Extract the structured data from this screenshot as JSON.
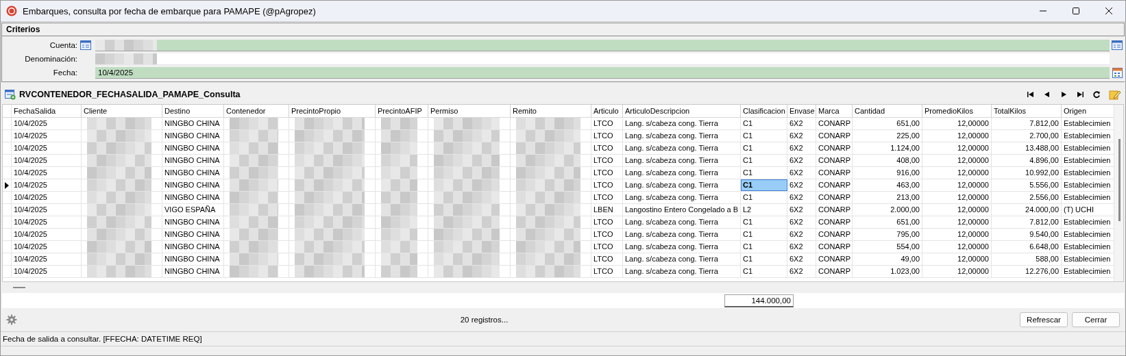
{
  "window": {
    "title": "Embarques, consulta por fecha de embarque para PAMAPE (@pAgropez)"
  },
  "criteria": {
    "title": "Criterios",
    "fields": [
      {
        "kind": "lookup",
        "label": "Cuenta:",
        "required": true
      },
      {
        "kind": "text",
        "label": "Denominación:",
        "required": false
      },
      {
        "kind": "date",
        "label": "Fecha:",
        "required": true,
        "value": "10/4/2025"
      }
    ]
  },
  "grid": {
    "title": "RVCONTENEDOR_FECHASALIDA_PAMAPE_Consulta",
    "columns": [
      "FechaSalida",
      "Cliente",
      "Destino",
      "Contenedor",
      "PrecintoPropio",
      "PrecintoAFIP",
      "Permiso",
      "Remito",
      "Articulo",
      "ArticuloDescripcion",
      "Clasificacion",
      "Envase",
      "Marca",
      "Cantidad",
      "PromedioKilos",
      "TotalKilos",
      "Origen"
    ],
    "rows": [
      {
        "current": false,
        "cells": [
          "10/4/2025",
          null,
          "NINGBO CHINA",
          null,
          null,
          null,
          null,
          null,
          "LTCO",
          "Lang. s/cabeza cong. Tierra",
          "C1",
          "6X2",
          "CONARP",
          "651,00",
          "12,00000",
          "7.812,00",
          "Establecimien"
        ]
      },
      {
        "current": false,
        "cells": [
          "10/4/2025",
          null,
          "NINGBO CHINA",
          null,
          null,
          null,
          null,
          null,
          "LTCO",
          "Lang. s/cabeza cong. Tierra",
          "C1",
          "6X2",
          "CONARP",
          "225,00",
          "12,00000",
          "2.700,00",
          "Establecimien"
        ]
      },
      {
        "current": false,
        "cells": [
          "10/4/2025",
          null,
          "NINGBO CHINA",
          null,
          null,
          null,
          null,
          null,
          "LTCO",
          "Lang. s/cabeza cong. Tierra",
          "C1",
          "6X2",
          "CONARP",
          "1.124,00",
          "12,00000",
          "13.488,00",
          "Establecimien"
        ]
      },
      {
        "current": false,
        "cells": [
          "10/4/2025",
          null,
          "NINGBO CHINA",
          null,
          null,
          null,
          null,
          null,
          "LTCO",
          "Lang. s/cabeza cong. Tierra",
          "C1",
          "6X2",
          "CONARP",
          "408,00",
          "12,00000",
          "4.896,00",
          "Establecimien"
        ]
      },
      {
        "current": false,
        "cells": [
          "10/4/2025",
          null,
          "NINGBO CHINA",
          null,
          null,
          null,
          null,
          null,
          "LTCO",
          "Lang. s/cabeza cong. Tierra",
          "C1",
          "6X2",
          "CONARP",
          "916,00",
          "12,00000",
          "10.992,00",
          "Establecimien"
        ]
      },
      {
        "current": true,
        "cells": [
          "10/4/2025",
          null,
          "NINGBO CHINA",
          null,
          null,
          null,
          null,
          null,
          "LTCO",
          "Lang. s/cabeza cong. Tierra",
          "C1",
          "6X2",
          "CONARP",
          "463,00",
          "12,00000",
          "5.556,00",
          "Establecimien"
        ]
      },
      {
        "current": false,
        "cells": [
          "10/4/2025",
          null,
          "NINGBO CHINA",
          null,
          null,
          null,
          null,
          null,
          "LTCO",
          "Lang. s/cabeza cong. Tierra",
          "C1",
          "6X2",
          "CONARP",
          "213,00",
          "12,00000",
          "2.556,00",
          "Establecimien"
        ]
      },
      {
        "current": false,
        "cells": [
          "10/4/2025",
          null,
          "VIGO ESPAÑA",
          null,
          null,
          null,
          null,
          null,
          "LBEN",
          "Langostino Entero Congelado a B",
          "L2",
          "6X2",
          "CONARP",
          "2.000,00",
          "12,00000",
          "24.000,00",
          "(T) UCHI"
        ]
      },
      {
        "current": false,
        "cells": [
          "10/4/2025",
          null,
          "NINGBO CHINA",
          null,
          null,
          null,
          null,
          null,
          "LTCO",
          "Lang. s/cabeza cong. Tierra",
          "C1",
          "6X2",
          "CONARP",
          "651,00",
          "12,00000",
          "7.812,00",
          "Establecimien"
        ]
      },
      {
        "current": false,
        "cells": [
          "10/4/2025",
          null,
          "NINGBO CHINA",
          null,
          null,
          null,
          null,
          null,
          "LTCO",
          "Lang. s/cabeza cong. Tierra",
          "C1",
          "6X2",
          "CONARP",
          "795,00",
          "12,00000",
          "9.540,00",
          "Establecimien"
        ]
      },
      {
        "current": false,
        "cells": [
          "10/4/2025",
          null,
          "NINGBO CHINA",
          null,
          null,
          null,
          null,
          null,
          "LTCO",
          "Lang. s/cabeza cong. Tierra",
          "C1",
          "6X2",
          "CONARP",
          "554,00",
          "12,00000",
          "6.648,00",
          "Establecimien"
        ]
      },
      {
        "current": false,
        "cells": [
          "10/4/2025",
          null,
          "NINGBO CHINA",
          null,
          null,
          null,
          null,
          null,
          "LTCO",
          "Lang. s/cabeza cong. Tierra",
          "C1",
          "6X2",
          "CONARP",
          "49,00",
          "12,00000",
          "588,00",
          "Establecimien"
        ]
      },
      {
        "current": false,
        "cells": [
          "10/4/2025",
          null,
          "NINGBO CHINA",
          null,
          null,
          null,
          null,
          null,
          "LTCO",
          "Lang. s/cabeza cong. Tierra",
          "C1",
          "6X2",
          "CONARP",
          "1.023,00",
          "12,00000",
          "12.276,00",
          "Establecimien"
        ]
      }
    ],
    "total": "144.000,00"
  },
  "footer": {
    "count": "20 registros...",
    "buttons": [
      "Refrescar",
      "Cerrar"
    ]
  },
  "status_bar": "Fecha de salida a consultar. [FFECHA: DATETIME REQ]"
}
